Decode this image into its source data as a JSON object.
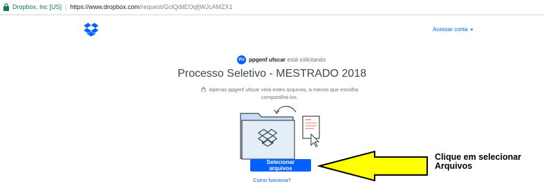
{
  "browser": {
    "secure_label": "Dropbox, Inc [US]",
    "url_host": "https://www.dropbox.com",
    "url_path": "/request/GclQdilEOqfjWJcAMZX1"
  },
  "header": {
    "account_label": "Acessar conta",
    "account_caret": "▾"
  },
  "request": {
    "avatar_initials": "PU",
    "requester_name": "ppgenf ufscar",
    "requester_suffix": "está solicitando",
    "title": "Processo Seletivo - MESTRADO 2018",
    "notice_line1": "Apenas ppgenf ufscar verá estes arquivos, a menos que escolha",
    "notice_line2": "compartilhá-los.",
    "select_button": "Selecionar arquivos",
    "how_link": "Como funciona?"
  },
  "annotation": {
    "line1": "Clique em selecionar",
    "line2": "Arquivos"
  },
  "colors": {
    "brand_blue": "#0061fe",
    "arrow_yellow": "#ffff00",
    "secure_green": "#0b8043"
  }
}
